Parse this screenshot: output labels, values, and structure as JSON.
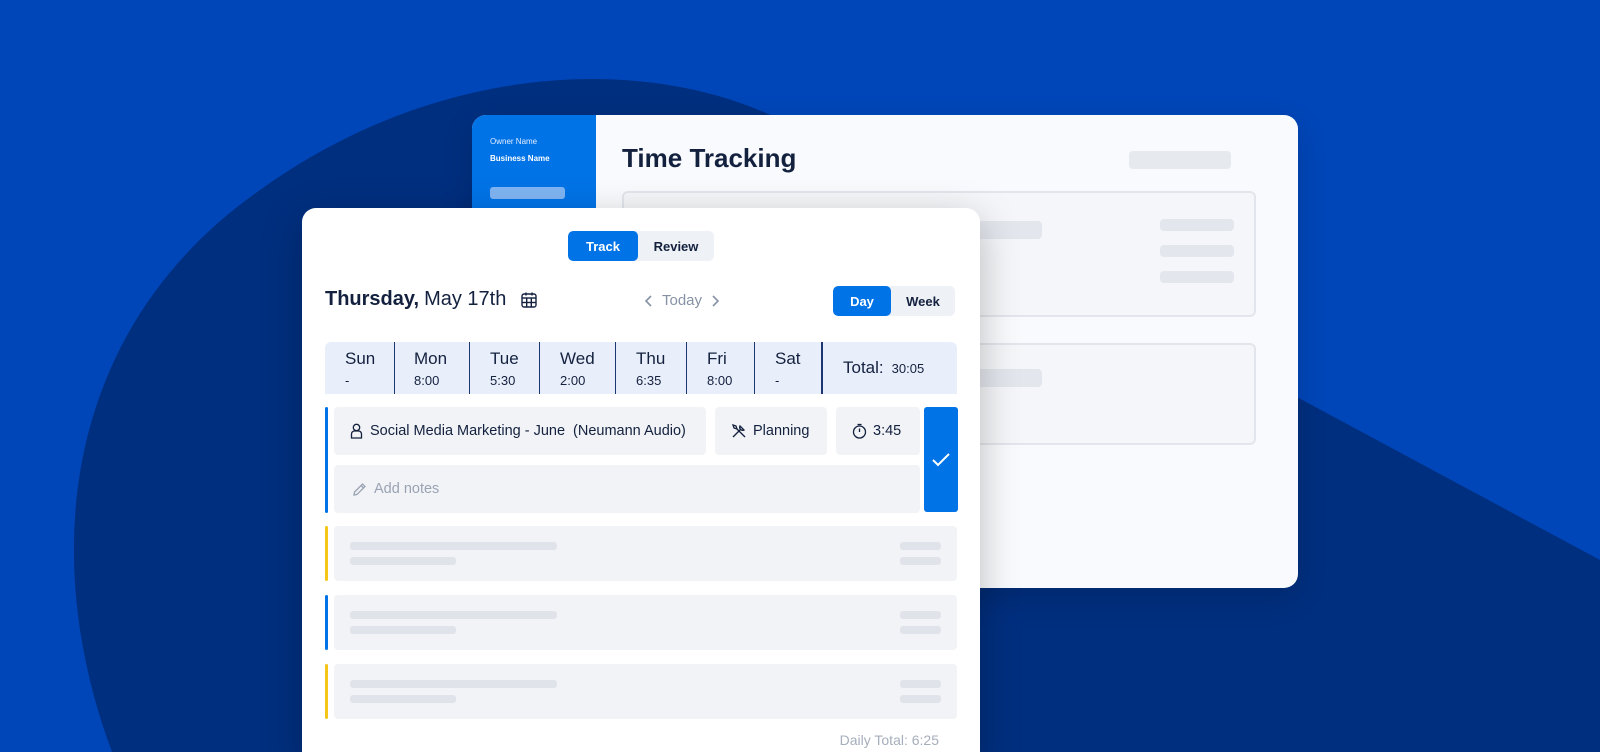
{
  "colors": {
    "background": "#0046b8",
    "background_dark": "#002f7f",
    "accent": "#0073e6",
    "bar_blue": "#0073e6",
    "bar_yellow": "#f5c518"
  },
  "back_window": {
    "owner_name": "Owner Name",
    "business_name": "Business Name",
    "title": "Time Tracking"
  },
  "front_window": {
    "mode_tabs": [
      {
        "label": "Track",
        "active": true
      },
      {
        "label": "Review",
        "active": false
      }
    ],
    "date": {
      "day": "Thursday,",
      "rest": "May 17th",
      "calendar_icon": "calendar-icon"
    },
    "nav": {
      "prev_icon": "chevron-left-icon",
      "today": "Today",
      "next_icon": "chevron-right-icon"
    },
    "view_tabs": [
      {
        "label": "Day",
        "active": true
      },
      {
        "label": "Week",
        "active": false
      }
    ],
    "week": [
      {
        "name": "Sun",
        "value": "-"
      },
      {
        "name": "Mon",
        "value": "8:00"
      },
      {
        "name": "Tue",
        "value": "5:30"
      },
      {
        "name": "Wed",
        "value": "2:00"
      },
      {
        "name": "Thu",
        "value": "6:35"
      },
      {
        "name": "Fri",
        "value": "8:00"
      },
      {
        "name": "Sat",
        "value": "-"
      }
    ],
    "total_label": "Total:",
    "total_value": "30:05",
    "entry": {
      "project": "Social Media Marketing - June",
      "client": "(Neumann Audio)",
      "project_icon": "user-icon",
      "service": "Planning",
      "service_icon": "tools-icon",
      "duration": "3:45",
      "timer_icon": "stopwatch-icon",
      "notes_placeholder": "Add notes",
      "notes_icon": "pencil-icon",
      "save_icon": "check-icon"
    },
    "daily_total": "Daily Total: 6:25"
  }
}
